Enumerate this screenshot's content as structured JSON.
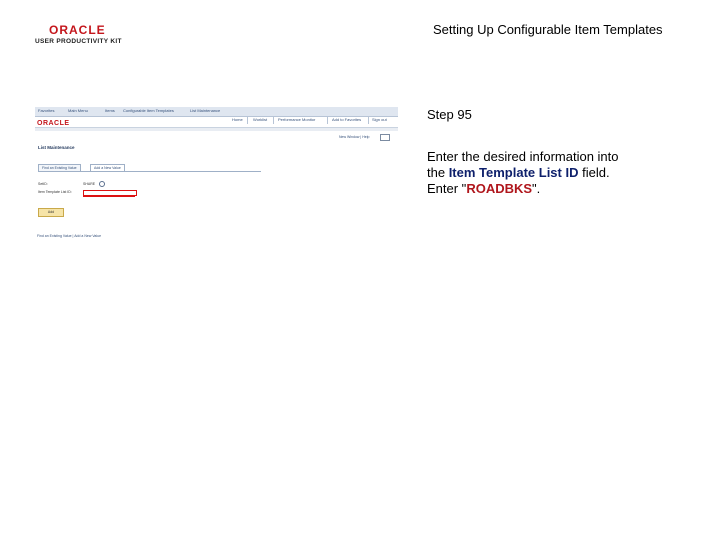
{
  "header": {
    "logo_text": "ORACLE",
    "logo_subtext": "USER PRODUCTIVITY KIT",
    "doc_title": "Setting Up Configurable Item Templates"
  },
  "screenshot": {
    "nav": {
      "items": [
        "Favorites",
        "Main Menu",
        "Items",
        "Configurable Item Templates",
        "List Maintenance"
      ]
    },
    "logo_text": "ORACLE",
    "links": [
      "Home",
      "Worklist",
      "Performance Monitor",
      "Add to Favorites",
      "Sign out"
    ],
    "new_window_text": "New Window | Help",
    "page_title": "List Maintenance",
    "tabs": [
      "Find an Existing Value",
      "Add a New Value"
    ],
    "setid_label": "SetID:",
    "setid_value": "SHARE",
    "list_id_label": "Item Template List ID:",
    "add_button": "Add",
    "footer": "Find an Existing Value | Add a New Value"
  },
  "instructions": {
    "step": "Step 95",
    "line1": "Enter the desired information into",
    "line2_prefix": "the ",
    "field_name": "Item Template List ID",
    "line2_suffix": " field.",
    "line3_prefix": "Enter \"",
    "value": "ROADBKS",
    "line3_suffix": "\"."
  },
  "colors": {
    "brand_red": "#c4161c",
    "field_highlight": "#0d1f6b",
    "value_highlight": "#b0161c",
    "input_outline": "#dd1111"
  }
}
